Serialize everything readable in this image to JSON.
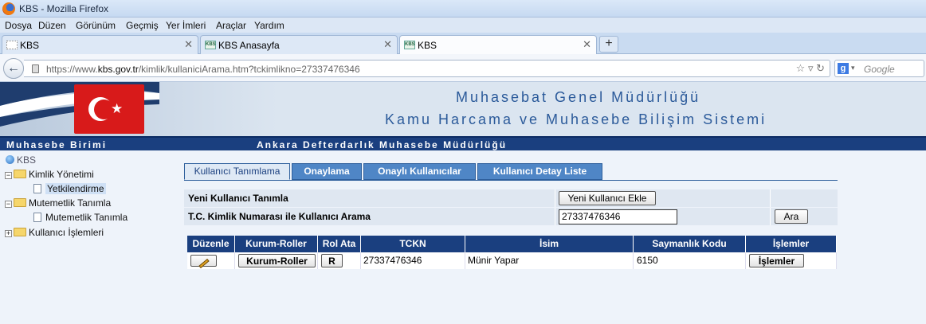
{
  "window": {
    "title": "KBS - Mozilla Firefox"
  },
  "menu": [
    "Dosya",
    "Düzen",
    "Görünüm",
    "Geçmiş",
    "Yer İmleri",
    "Araçlar",
    "Yardım"
  ],
  "browser_tabs": [
    {
      "label": "KBS",
      "active": false,
      "icon": "blank-page-icon"
    },
    {
      "label": "KBS Anasayfa",
      "active": false,
      "icon": "kbs-favicon"
    },
    {
      "label": "KBS",
      "active": true,
      "icon": "kbs-favicon"
    }
  ],
  "address": {
    "prefix": "https://www.",
    "domain": "kbs.gov.tr",
    "path": "/kimlik/kullaniciArama.htm?tckimlikno=27337476346"
  },
  "search": {
    "placeholder": "Google"
  },
  "favicon_text": "KBS",
  "banner": {
    "line1": "Muhasebat Genel Müdürlüğü",
    "line2": "Kamu Harcama ve Muhasebe Bilişim Sistemi"
  },
  "infobar": {
    "left": "Muhasebe Birimi",
    "right": "Ankara Defterdarlık Muhasebe Müdürlüğü"
  },
  "sidebar": {
    "root": "KBS",
    "items": [
      {
        "label": "Kimlik Yönetimi"
      },
      {
        "label": "Yetkilendirme"
      },
      {
        "label": "Mutemetlik Tanımla"
      },
      {
        "label": "Mutemetlik Tanımla"
      },
      {
        "label": "Kullanıcı İşlemleri"
      }
    ]
  },
  "app_tabs": [
    "Kullanıcı Tanımlama",
    "Onaylama",
    "Onaylı Kullanıcılar",
    "Kullanıcı Detay Liste"
  ],
  "form": {
    "new_user_label": "Yeni Kullanıcı Tanımla",
    "new_user_button": "Yeni Kullanıcı Ekle",
    "search_label": "T.C. Kimlik Numarası ile Kullanıcı Arama",
    "tckn_value": "27337476346",
    "search_button": "Ara"
  },
  "grid": {
    "headers": [
      "Düzenle",
      "Kurum-Roller",
      "Rol Ata",
      "TCKN",
      "İsim",
      "Saymanlık Kodu",
      "İşlemler"
    ],
    "row": {
      "kurum_roller_button": "Kurum-Roller",
      "rol_ata_button": "R",
      "tckn": "27337476346",
      "isim": "Münir Yapar",
      "saymanlik_kodu": "6150",
      "islemler_button": "İşlemler"
    }
  },
  "colors": {
    "header_navy": "#1a3f7f",
    "tab_blue": "#4f86c6",
    "flag_red": "#d81a1a"
  }
}
